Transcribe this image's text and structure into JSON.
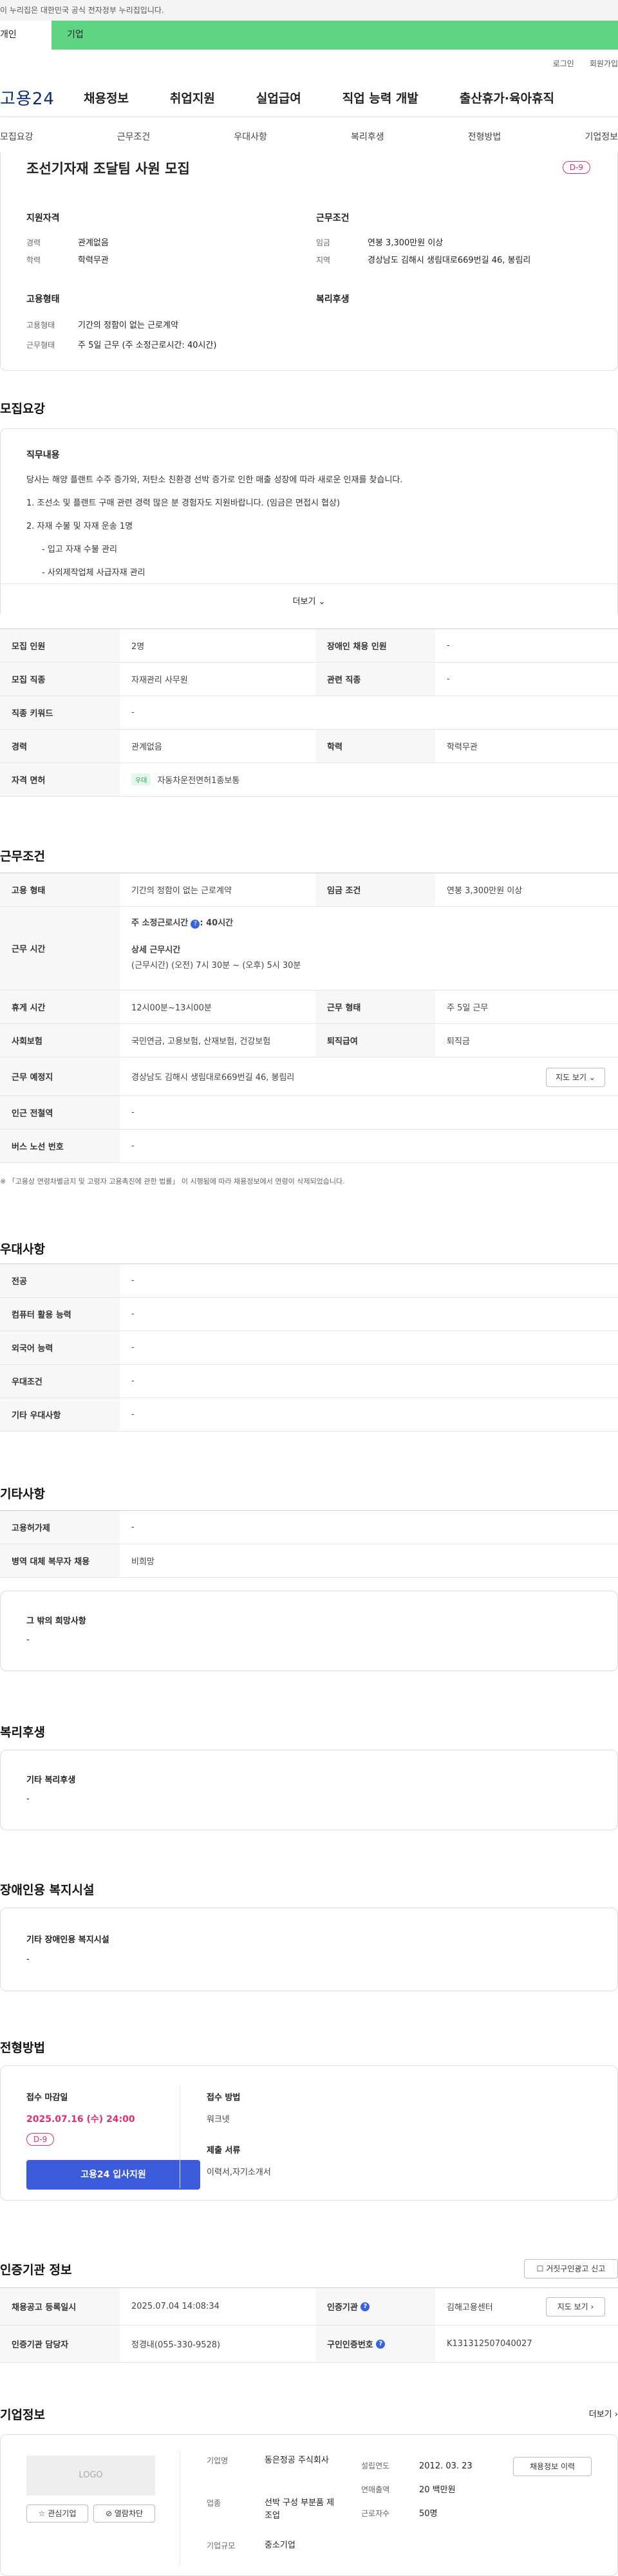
{
  "gov_banner": "이 누리집은 대한민국 공식 전자정부 누리집입니다.",
  "tabs": [
    "개인",
    "기업"
  ],
  "util": [
    "로그인",
    "회원가입"
  ],
  "logo": "고용24",
  "gnb": [
    "채용정보",
    "취업지원",
    "실업급여",
    "직업 능력 개발",
    "출산휴가·육아휴직"
  ],
  "snb": [
    "모집요강",
    "근무조건",
    "우대사항",
    "복리후생",
    "전형방법",
    "기업정보"
  ],
  "job": {
    "title": "조선기자재 조달팀 사원 모집",
    "dday": "D-9",
    "qual_title": "지원자격",
    "qual": [
      [
        "경력",
        "관계없음"
      ],
      [
        "학력",
        "학력무관"
      ]
    ],
    "work_title": "근무조건",
    "work": [
      [
        "임금",
        "연봉 3,300만원 이상"
      ],
      [
        "지역",
        "경상남도 김해시 생림대로669번길 46, 봉림리"
      ]
    ],
    "emp_title": "고용형태",
    "emp": [
      [
        "고용형태",
        "기간의 정함이 없는 근로계약"
      ],
      [
        "근무형태",
        "주 5일 근무 (주 소정근로시간: 40시간)"
      ]
    ],
    "welfare_title": "복리후생"
  },
  "recruit": {
    "title": "모집요강",
    "duty_title": "직무내용",
    "duty_lines": [
      "당사는 해양 플랜트 수주 증가와, 저탄소 친환경 선박 증가로 인한 매출 성장에 따라 새로운 인재를 찾습니다.",
      "1. 조선소 및 플랜트 구매 관련 경력 많은 분 경험자도 지원바랍니다. (임금은 면접시 협상)",
      "2.   자재 수불 및 자재 운송 1명",
      "- 입고 자재 수불 관리",
      "- 사외제작업체 사급자재 관리"
    ],
    "more": "더보기",
    "rows": [
      [
        "모집 인원",
        "2명",
        "장애인 채용 인원",
        "-"
      ],
      [
        "모집 직종",
        "자재관리 사무원",
        "관련 직종",
        "-"
      ],
      [
        "직종 키워드",
        "-",
        "",
        ""
      ],
      [
        "경력",
        "관계없음",
        "학력",
        "학력무관"
      ],
      [
        "자격 면허",
        "자동차운전면허1종보통",
        "",
        ""
      ]
    ],
    "license_tag": "우대"
  },
  "cond": {
    "title": "근무조건",
    "emp_type": [
      "고용 형태",
      "기간의 정함이 없는 근로계약",
      "임금 조건",
      "연봉 3,300만원 이상"
    ],
    "hours_th": "근무 시간",
    "hours_weekly": "주 소정근로시간",
    "hours_weekly_val": ": 40시간",
    "hours_detail_t": "상세 근무시간",
    "hours_detail": "(근무시간) (오전) 7시 30분 ~ (오후) 5시 30분",
    "rows": [
      [
        "휴게 시간",
        "12시00분~13시00분",
        "근무 형태",
        "주 5일 근무"
      ],
      [
        "사회보험",
        "국민연금, 고용보험, 산재보험, 건강보험",
        "퇴직급여",
        "퇴직금"
      ]
    ],
    "place": [
      "근무 예정지",
      "경상남도 김해시 생림대로669번길 46, 봉림리"
    ],
    "map_btn": "지도 보기",
    "rows2": [
      [
        "인근 전철역",
        "-"
      ],
      [
        "버스 노선 번호",
        "-"
      ]
    ],
    "note": "※ 「고용상 연령차별금지 및 고령자 고용촉진에 관한 법률」 이 시행됨에 따라 채용정보에서 연령이 삭제되었습니다."
  },
  "pref": {
    "title": "우대사항",
    "rows": [
      [
        "전공",
        "-"
      ],
      [
        "컴퓨터 활용 능력",
        "-"
      ],
      [
        "외국어 능력",
        "-"
      ],
      [
        "우대조건",
        "-"
      ],
      [
        "기타 우대사항",
        "-"
      ]
    ]
  },
  "etc": {
    "title": "기타사항",
    "rows": [
      [
        "고용허가제",
        "-"
      ],
      [
        "병역 대체 복무자 채용",
        "비희망"
      ]
    ],
    "box_title": "그 밖의 희망사항",
    "box_val": "-"
  },
  "welfare": {
    "title": "복리후생",
    "box_title": "기타 복리후생",
    "box_val": "-"
  },
  "disab": {
    "title": "장애인용 복지시설",
    "box_title": "기타 장애인용 복지시설",
    "box_val": "-"
  },
  "proc": {
    "title": "전형방법",
    "deadline_t": "접수 마감일",
    "deadline": "2025.07.16 (수) 24:00",
    "dday": "D-9",
    "apply_btn": "고용24 입사지원",
    "method_t": "접수 방법",
    "method": "워크넷",
    "docs_t": "제출 서류",
    "docs": "이력서,자기소개서"
  },
  "agency": {
    "title": "인증기관 정보",
    "report_btn": "거짓구인광고 신고",
    "r1": [
      "채용공고 등록일시",
      "2025.07.04 14:08:34",
      "인증기관",
      "김해고용센터"
    ],
    "map_btn": "지도 보기",
    "r2": [
      "인증기관 담당자",
      "정경내(055-330-9528)",
      "구인인증번호",
      "K131312507040027"
    ]
  },
  "company": {
    "title": "기업정보",
    "more": "더보기",
    "logo": "LOGO",
    "fav_btn": "관심기업",
    "block_btn": "열람차단",
    "f": [
      [
        "기업명",
        "동은정공 주식회사"
      ],
      [
        "업종",
        "선박 구성 부분품 제조업"
      ],
      [
        "기업규모",
        "중소기업"
      ]
    ],
    "g": [
      [
        "설립연도",
        "2012. 03. 23"
      ],
      [
        "연매출액",
        "20 백만원"
      ],
      [
        "근로자수",
        "50명"
      ]
    ],
    "info_btn": "채용정보 이력"
  }
}
